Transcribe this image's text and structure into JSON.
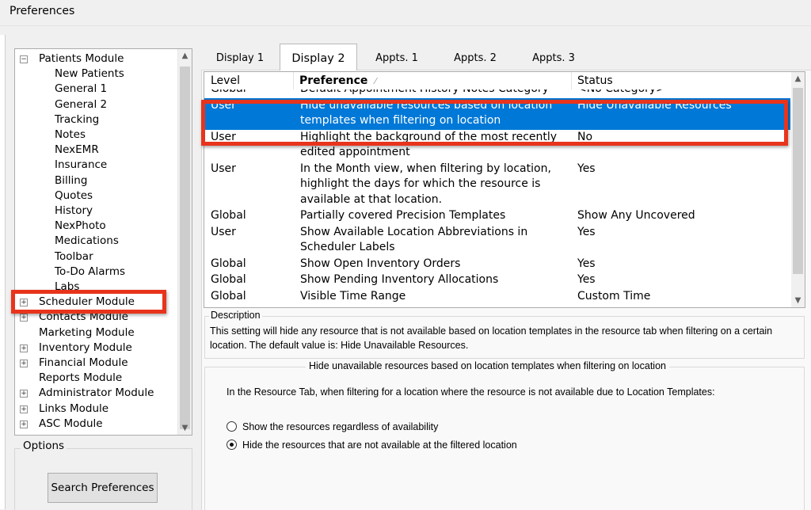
{
  "window": {
    "title": "Preferences"
  },
  "tree": {
    "items": [
      {
        "label": "Patients Module",
        "level": 0,
        "expander": "−"
      },
      {
        "label": "New Patients",
        "level": 1
      },
      {
        "label": "General 1",
        "level": 1
      },
      {
        "label": "General 2",
        "level": 1
      },
      {
        "label": "Tracking",
        "level": 1
      },
      {
        "label": "Notes",
        "level": 1
      },
      {
        "label": "NexEMR",
        "level": 1
      },
      {
        "label": "Insurance",
        "level": 1
      },
      {
        "label": "Billing",
        "level": 1
      },
      {
        "label": "Quotes",
        "level": 1
      },
      {
        "label": "History",
        "level": 1
      },
      {
        "label": "NexPhoto",
        "level": 1
      },
      {
        "label": "Medications",
        "level": 1
      },
      {
        "label": "Toolbar",
        "level": 1
      },
      {
        "label": "To-Do Alarms",
        "level": 1
      },
      {
        "label": "Labs",
        "level": 1
      },
      {
        "label": "Scheduler Module",
        "level": 0,
        "expander": "+",
        "highlighted": true
      },
      {
        "label": "Contacts Module",
        "level": 0,
        "expander": "+"
      },
      {
        "label": "Marketing Module",
        "level": 0
      },
      {
        "label": "Inventory Module",
        "level": 0,
        "expander": "+"
      },
      {
        "label": "Financial Module",
        "level": 0,
        "expander": "+"
      },
      {
        "label": "Reports Module",
        "level": 0
      },
      {
        "label": "Administrator Module",
        "level": 0,
        "expander": "+"
      },
      {
        "label": "Links Module",
        "level": 0,
        "expander": "+"
      },
      {
        "label": "ASC Module",
        "level": 0,
        "expander": "+"
      }
    ],
    "scroll_up_icon": "▲",
    "scroll_down_icon": "▼"
  },
  "options": {
    "label": "Options",
    "search_button": "Search Preferences"
  },
  "tabs": [
    {
      "label": "Display 1"
    },
    {
      "label": "Display 2",
      "active": true
    },
    {
      "label": "Appts. 1"
    },
    {
      "label": "Appts. 2"
    },
    {
      "label": "Appts. 3"
    }
  ],
  "pref_list": {
    "headers": {
      "level": "Level",
      "preference": "Preference",
      "status": "Status",
      "sort_icon": "⁄"
    },
    "rows": [
      {
        "level": "Global",
        "preference": "Default Appointment History Notes Category",
        "status": "<No Category>"
      },
      {
        "level": "User",
        "preference": "Hide unavailable resources based on location templates when filtering on location",
        "status": "Hide Unavailable Resources",
        "selected": true
      },
      {
        "level": "User",
        "preference": "Highlight the background of the most recently edited appointment",
        "status": "No"
      },
      {
        "level": "User",
        "preference": "In the Month view, when filtering by location, highlight the days for which the resource is available at that location.",
        "status": "Yes"
      },
      {
        "level": "Global",
        "preference": "Partially covered Precision Templates",
        "status": "Show Any Uncovered"
      },
      {
        "level": "User",
        "preference": "Show Available Location Abbreviations in Scheduler Labels",
        "status": "Yes"
      },
      {
        "level": "Global",
        "preference": "Show Open Inventory Orders",
        "status": "Yes"
      },
      {
        "level": "Global",
        "preference": "Show Pending Inventory Allocations",
        "status": "Yes"
      },
      {
        "level": "Global",
        "preference": "Visible Time Range",
        "status": "Custom Time"
      }
    ],
    "scroll_up_icon": "▲",
    "scroll_down_icon": "▼"
  },
  "description": {
    "label": "Description",
    "text": "This setting will hide any resource that is not available based on location templates in the resource tab when filtering on a certain location.  The default value is: Hide Unavailable Resources."
  },
  "setting": {
    "title": "Hide unavailable resources based on location templates when filtering on location",
    "text": "In the Resource Tab, when filtering for a location where the resource is not available due to Location Templates:",
    "options": [
      {
        "label": "Show the resources regardless of availability",
        "checked": false
      },
      {
        "label": "Hide the resources that are not available at the filtered location",
        "checked": true
      }
    ]
  },
  "colors": {
    "selection": "#0078d7",
    "highlight_box": "#e8341c"
  }
}
